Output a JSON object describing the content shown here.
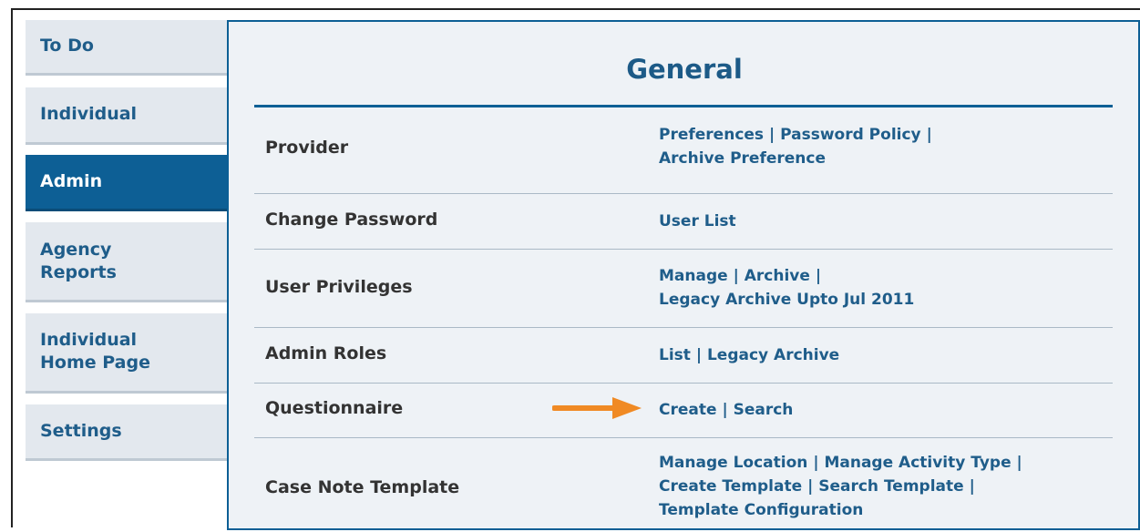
{
  "sidebar": {
    "items": [
      {
        "label": "To Do"
      },
      {
        "label": "Individual"
      },
      {
        "label": "Admin",
        "active": true
      },
      {
        "label": "Agency",
        "label2": "Reports"
      },
      {
        "label": "Individual",
        "label2": "Home Page"
      },
      {
        "label": "Settings"
      }
    ]
  },
  "main": {
    "title": "General",
    "rows": [
      {
        "label": "Provider",
        "links": [
          "Preferences",
          "Password Policy",
          "Archive Preference"
        ]
      },
      {
        "label": "Change Password",
        "links": [
          "User List"
        ]
      },
      {
        "label": "User Privileges",
        "links": [
          "Manage",
          "Archive",
          "Legacy Archive Upto Jul 2011"
        ]
      },
      {
        "label": "Admin Roles",
        "links": [
          "List",
          "Legacy Archive"
        ]
      },
      {
        "label": "Questionnaire",
        "links": [
          "Create",
          "Search"
        ]
      },
      {
        "label": "Case Note Template",
        "links": [
          "Manage Location",
          "Manage Activity Type",
          "Create Template",
          "Search Template",
          "Template Configuration"
        ]
      }
    ],
    "separator": "|"
  },
  "colors": {
    "accent": "#0d5f95",
    "arrow": "#f08a24"
  },
  "icons": {
    "pointer": "arrow-right-icon"
  }
}
